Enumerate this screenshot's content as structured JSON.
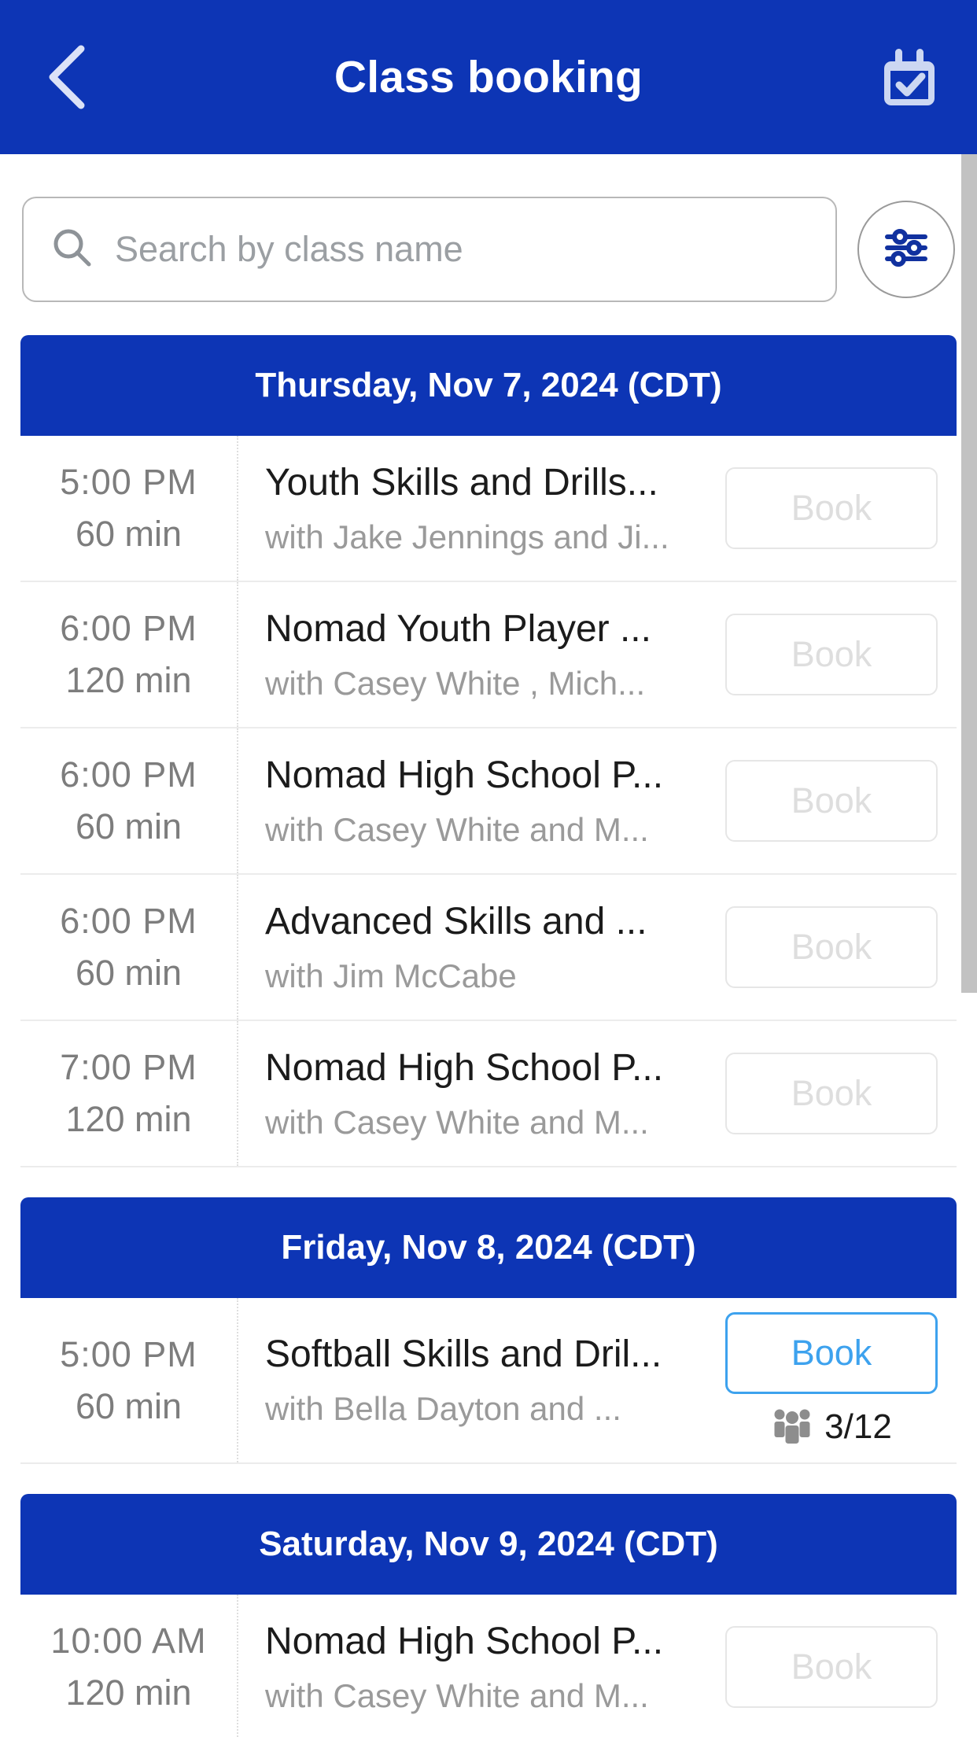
{
  "header": {
    "title": "Class booking",
    "back_icon": "chevron-left-icon",
    "calendar_icon": "calendar-check-icon"
  },
  "search": {
    "placeholder": "Search by class name",
    "value": "",
    "search_icon": "search-icon",
    "filter_icon": "sliders-filter-icon"
  },
  "colors": {
    "header_blue": "#0d35b5",
    "day_header_blue": "#0d35b5",
    "book_enabled_border": "#3da2ee",
    "book_enabled_text": "#3da2ee",
    "book_disabled_text": "#dedede",
    "muted_text": "#7d7d7d",
    "title_text": "#1b1b1b"
  },
  "sections": [
    {
      "day_label": "Thursday, Nov 7, 2024 (CDT)",
      "classes": [
        {
          "time": "5:00  PM",
          "duration": "60 min",
          "title": "Youth Skills and Drills...",
          "instructors": "with Jake Jennings and Ji...",
          "book_label": "Book",
          "enabled": false,
          "capacity": null
        },
        {
          "time": "6:00  PM",
          "duration": "120 min",
          "title": "Nomad Youth Player ...",
          "instructors": "with Casey White , Mich...",
          "book_label": "Book",
          "enabled": false,
          "capacity": null
        },
        {
          "time": "6:00  PM",
          "duration": "60 min",
          "title": "Nomad High School P...",
          "instructors": "with Casey White and M...",
          "book_label": "Book",
          "enabled": false,
          "capacity": null
        },
        {
          "time": "6:00  PM",
          "duration": "60 min",
          "title": "Advanced Skills and ...",
          "instructors": "with Jim McCabe",
          "book_label": "Book",
          "enabled": false,
          "capacity": null
        },
        {
          "time": "7:00  PM",
          "duration": "120 min",
          "title": "Nomad High School P...",
          "instructors": "with Casey White and M...",
          "book_label": "Book",
          "enabled": false,
          "capacity": null
        }
      ]
    },
    {
      "day_label": "Friday, Nov 8, 2024 (CDT)",
      "classes": [
        {
          "time": "5:00  PM",
          "duration": "60 min",
          "title": "Softball Skills and Dril...",
          "instructors": "with Bella Dayton and ...",
          "book_label": "Book",
          "enabled": true,
          "capacity": "3/12"
        }
      ]
    },
    {
      "day_label": "Saturday, Nov 9, 2024 (CDT)",
      "classes": [
        {
          "time": "10:00  AM",
          "duration": "120 min",
          "title": "Nomad High School P...",
          "instructors": "with Casey White and M...",
          "book_label": "Book",
          "enabled": false,
          "capacity": null
        }
      ]
    }
  ]
}
